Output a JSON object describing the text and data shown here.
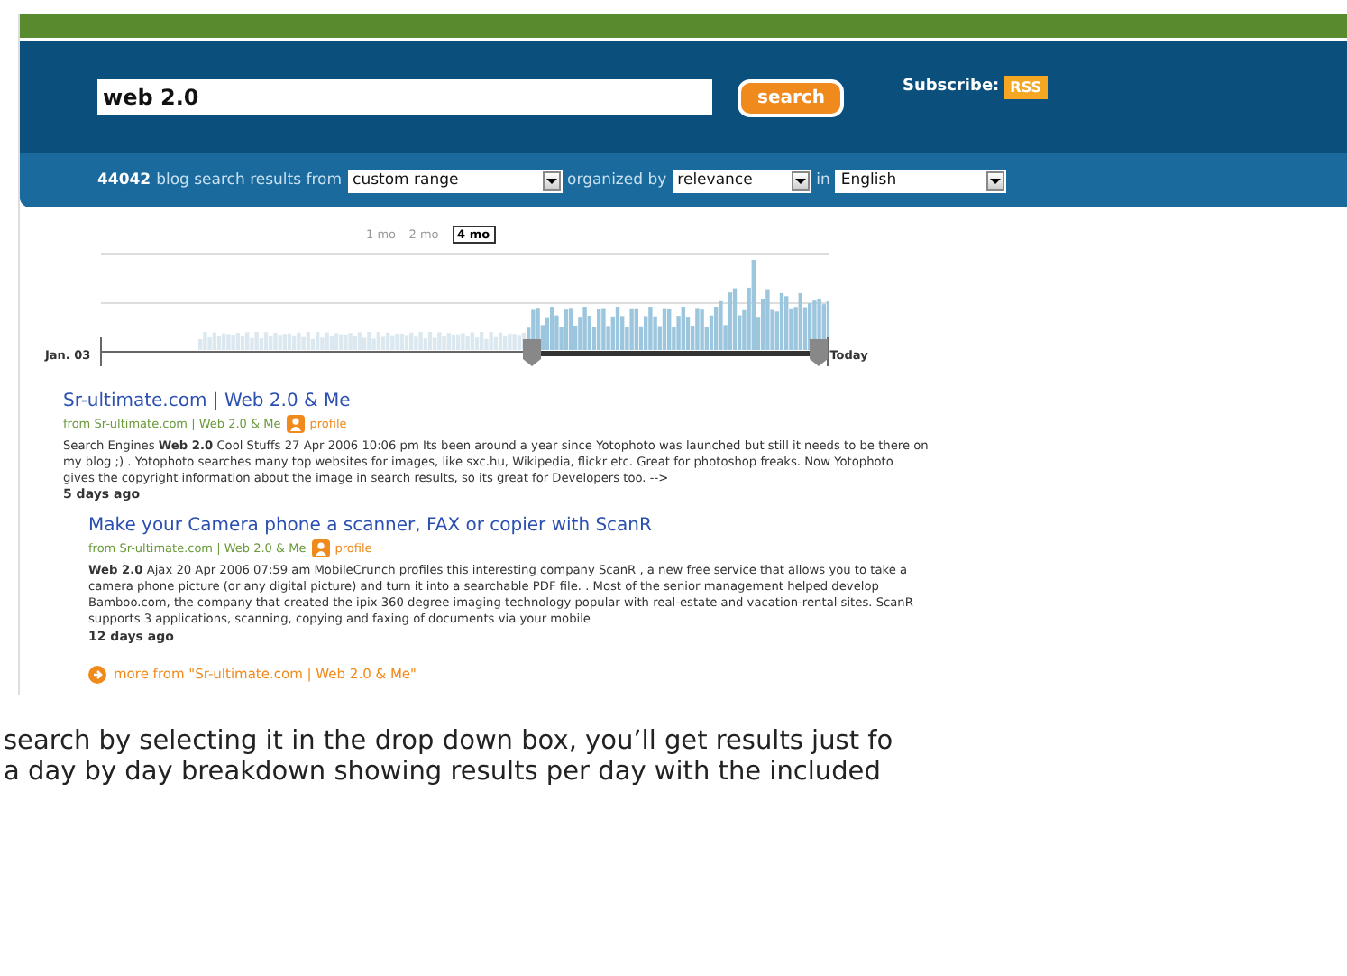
{
  "search": {
    "value": "web 2.0",
    "button": "search",
    "subscribe_label": "Subscribe:",
    "rss_badge": "RSS"
  },
  "filter_bar": {
    "count": "44042",
    "text_1": "blog search results from",
    "range": "custom range",
    "text_2": "organized by",
    "order": "relevance",
    "text_3": "in",
    "language": "English"
  },
  "timeline": {
    "zoom_separator": "–",
    "zoom_options": [
      {
        "label": "1 mo",
        "selected": false
      },
      {
        "label": "2 mo",
        "selected": false
      },
      {
        "label": "4 mo",
        "selected": true
      }
    ],
    "start_label": "Jan. 03",
    "end_label": "Today"
  },
  "results": [
    {
      "title": "Sr-ultimate.com | Web 2.0 & Me",
      "source": "from Sr-ultimate.com | Web 2.0 & Me",
      "profile": "profile",
      "lines": [
        "Search Engines **Web 2.0** Cool Stuffs 27 Apr 2006 10:06 pm Its been around a year since Yotophoto was launched but still it needs to be there on",
        "my blog ;) . Yotophoto searches many top websites for images, like sxc.hu, Wikipedia, flickr etc. Great for photoshop freaks. Now Yotophoto",
        "gives the copyright information about the image in search results, so its great for Developers too. -->"
      ],
      "age": "5 days ago"
    },
    {
      "title": "Make your Camera phone a scanner, FAX or copier with ScanR",
      "source": "from Sr-ultimate.com | Web 2.0 & Me",
      "profile": "profile",
      "lines": [
        "**Web 2.0** Ajax 20 Apr 2006 07:59 am MobileCrunch profiles this interesting company ScanR , a new free service that allows you to take a",
        "camera phone picture (or any digital picture) and turn it into a searchable PDF file. . Most of the senior management helped develop",
        "Bamboo.com, the company that created the ipix 360 degree imaging technology popular with real-estate and vacation-rental sites. ScanR",
        "supports 3 applications, scanning, copying and faxing of documents via your mobile"
      ],
      "age": "12 days ago"
    }
  ],
  "more_link": "more from \"Sr-ultimate.com | Web 2.0 & Me\"",
  "article_lines": [
    "search by selecting it in the drop down box, you’ll get results just fo",
    "a day by day breakdown showing results per day with the included"
  ]
}
